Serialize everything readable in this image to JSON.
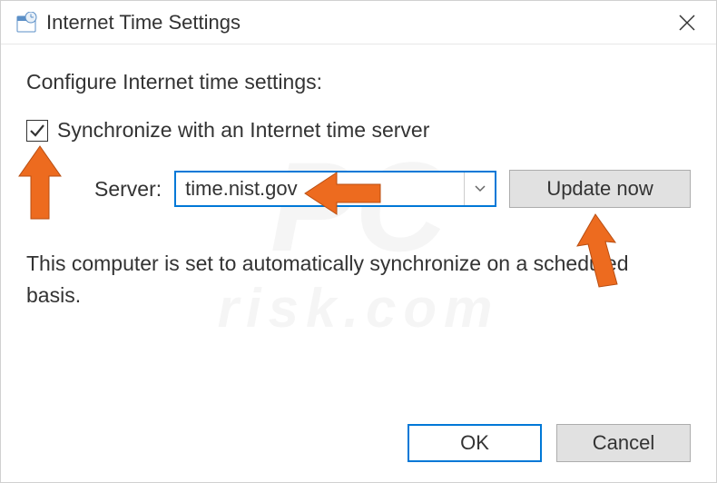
{
  "window": {
    "title": "Internet Time Settings"
  },
  "content": {
    "instruction": "Configure Internet time settings:",
    "checkbox_label": "Synchronize with an Internet time server",
    "checkbox_checked": true,
    "server_label": "Server:",
    "server_value": "time.nist.gov",
    "update_button": "Update now",
    "status_text": "This computer is set to automatically synchronize on a scheduled basis."
  },
  "buttons": {
    "ok": "OK",
    "cancel": "Cancel"
  },
  "watermark": {
    "main": "PC",
    "sub": "risk.com"
  },
  "annotations": {
    "arrow_color": "#ed6b1f"
  }
}
